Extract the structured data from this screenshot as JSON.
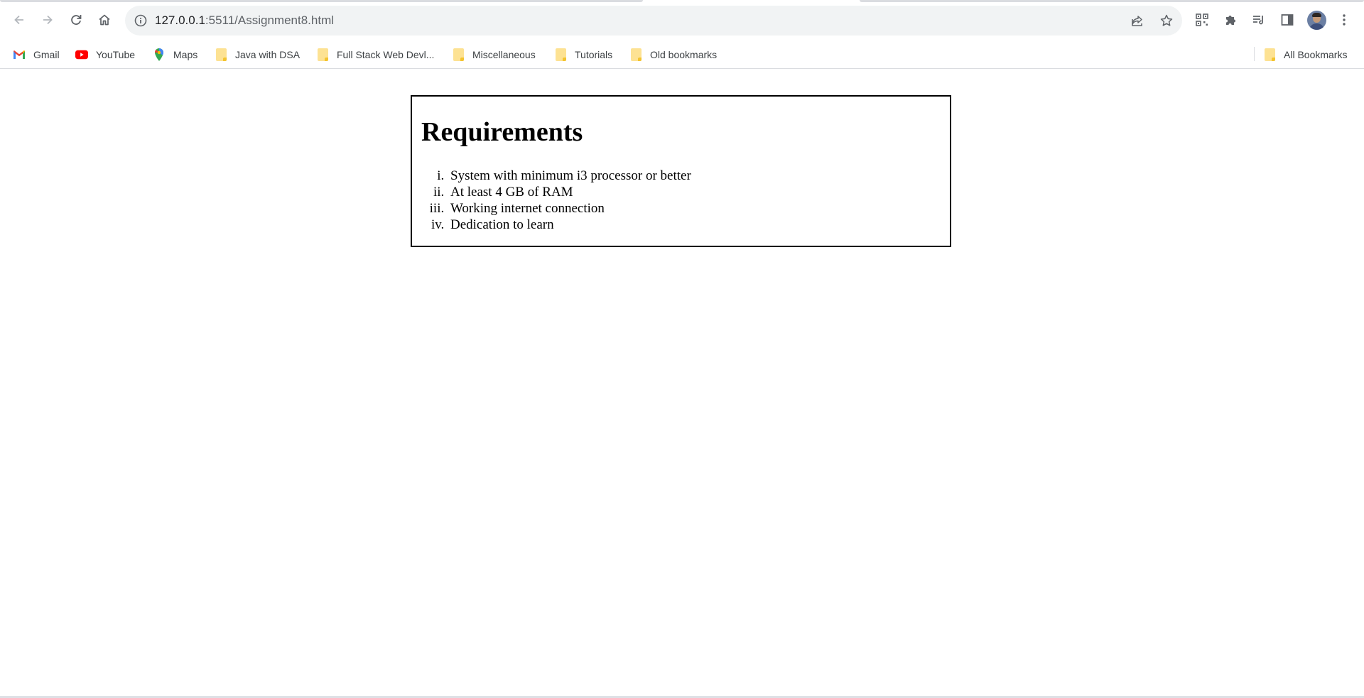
{
  "browser": {
    "url_host": "127.0.0.1",
    "url_rest": ":5511/Assignment8.html",
    "icons": {
      "back": "arrow-left-icon",
      "forward": "arrow-right-icon",
      "reload": "reload-icon",
      "home": "home-icon",
      "site_info": "info-icon",
      "share": "share-icon",
      "bookmark_star": "star-icon",
      "qr": "qr-code-icon",
      "extensions": "puzzle-icon",
      "reading_list": "reading-list-icon",
      "side_panel": "side-panel-icon",
      "menu": "kebab-menu-icon"
    }
  },
  "bookmarks": {
    "items": [
      {
        "label": "Gmail",
        "icon": "gmail-icon"
      },
      {
        "label": "YouTube",
        "icon": "youtube-icon"
      },
      {
        "label": "Maps",
        "icon": "maps-pin-icon"
      },
      {
        "label": "Java with DSA",
        "icon": "folder-icon"
      },
      {
        "label": "Full Stack Web Devl...",
        "icon": "folder-icon"
      },
      {
        "label": "Miscellaneous",
        "icon": "folder-icon"
      },
      {
        "label": "Tutorials",
        "icon": "folder-icon"
      },
      {
        "label": "Old bookmarks",
        "icon": "folder-icon"
      }
    ],
    "all_bookmarks": {
      "label": "All Bookmarks",
      "icon": "folder-icon"
    }
  },
  "page": {
    "heading": "Requirements",
    "list_items": [
      "System with minimum i3 processor or better",
      "At least 4 GB of RAM",
      "Working internet connection",
      "Dedication to learn"
    ]
  },
  "colors": {
    "omnibox_bg": "#f1f3f4",
    "folder": "#fde293",
    "youtube_red": "#ff0000"
  }
}
